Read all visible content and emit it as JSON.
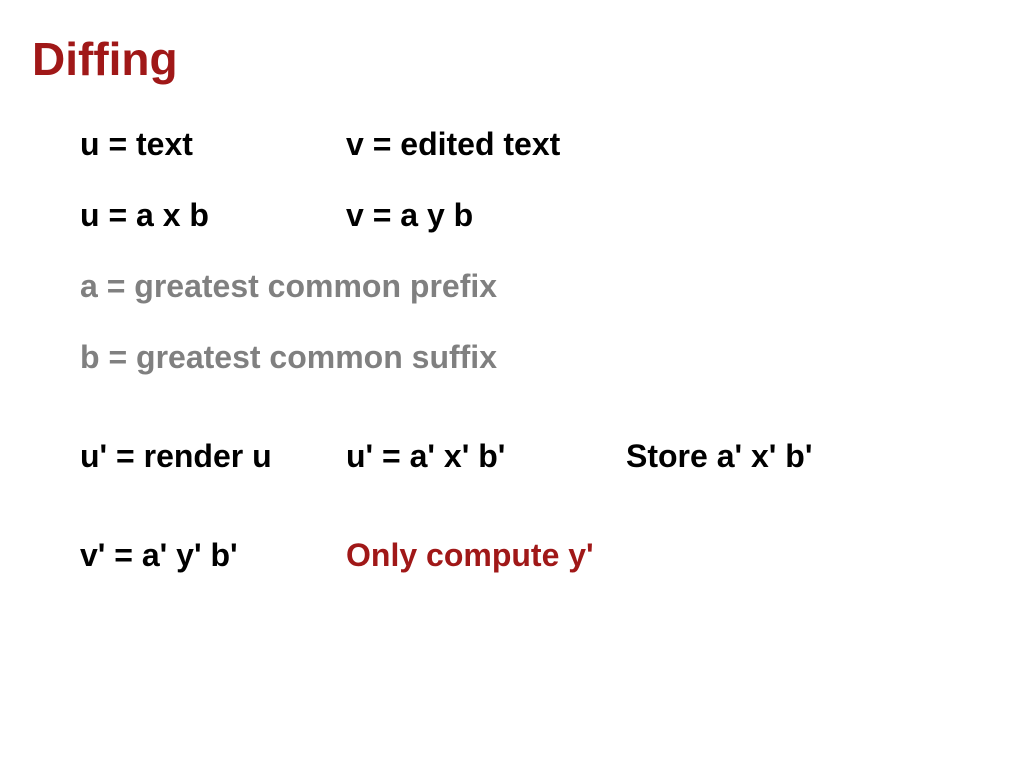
{
  "title": "Diffing",
  "lines": {
    "r1c1": "u = text",
    "r1c2": "v = edited text",
    "r2c1": "u = a x b",
    "r2c2": "v = a y b",
    "r3": "a = greatest common prefix",
    "r4": "b = greatest common suffix",
    "r5c1": "u' = render u",
    "r5c2": "u' = a' x' b'",
    "r5c3": "Store a' x' b'",
    "r6c1": "v' = a' y' b'",
    "r6c2": "Only compute y'"
  }
}
